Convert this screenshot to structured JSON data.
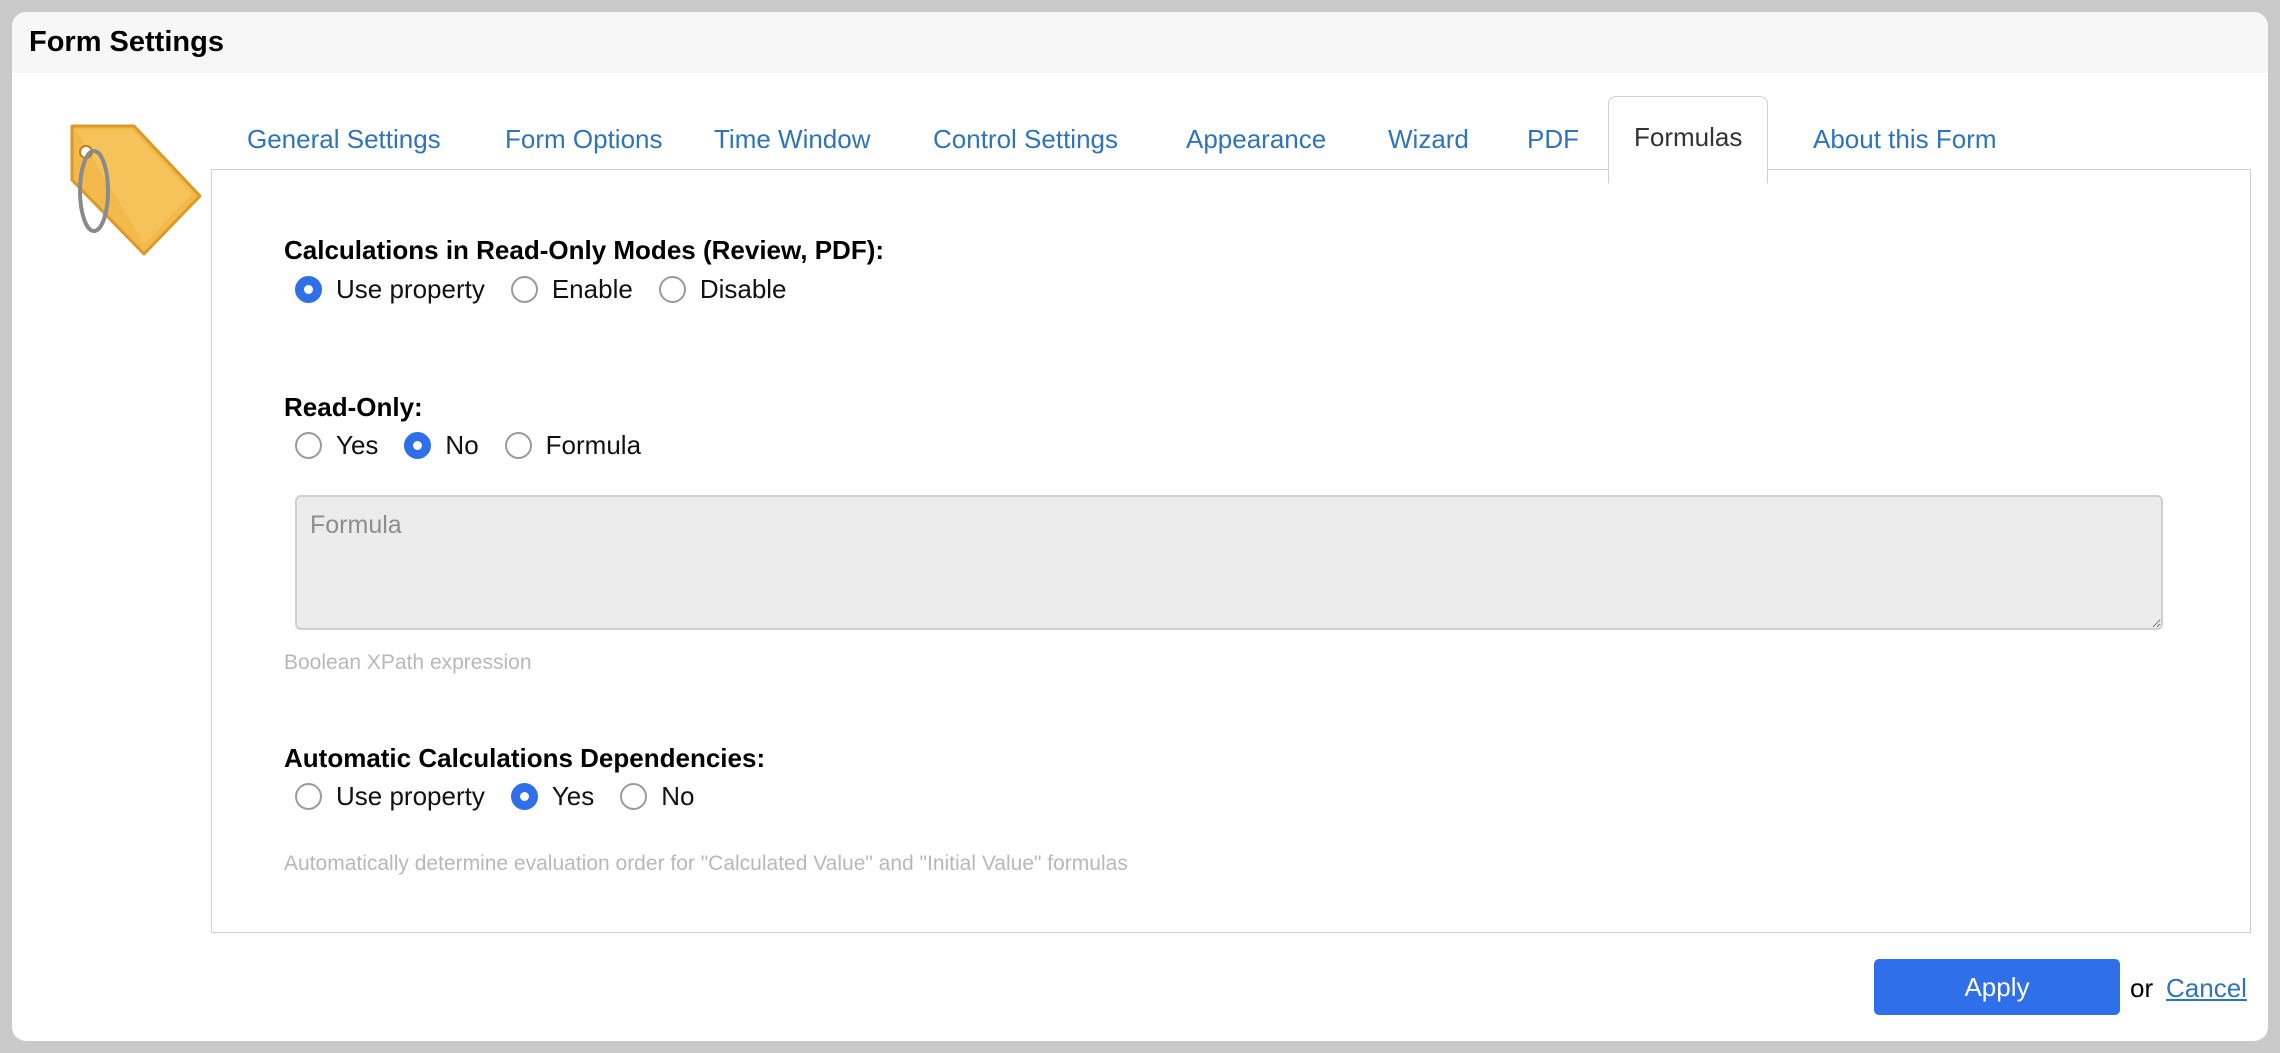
{
  "dialog": {
    "title": "Form Settings"
  },
  "icons": {
    "logo": "tag-icon",
    "grip": "resize-grip-icon"
  },
  "colors": {
    "accent": "#2f6fea",
    "link": "#2f74b9",
    "tag": "#f3b94a"
  },
  "tabs": [
    {
      "label": "General Settings",
      "active": false
    },
    {
      "label": "Form Options",
      "active": false
    },
    {
      "label": "Time Window",
      "active": false
    },
    {
      "label": "Control Settings",
      "active": false
    },
    {
      "label": "Appearance",
      "active": false
    },
    {
      "label": "Wizard",
      "active": false
    },
    {
      "label": "PDF",
      "active": false
    },
    {
      "label": "Formulas",
      "active": true
    },
    {
      "label": "About this Form",
      "active": false
    }
  ],
  "calc_readonly": {
    "label": "Calculations in Read-Only Modes (Review, PDF):",
    "options": [
      "Use property",
      "Enable",
      "Disable"
    ],
    "selected": "Use property"
  },
  "read_only": {
    "label": "Read-Only:",
    "options": [
      "Yes",
      "No",
      "Formula"
    ],
    "selected": "No",
    "formula_placeholder": "Formula",
    "formula_value": "",
    "hint": "Boolean XPath expression"
  },
  "auto_deps": {
    "label": "Automatic Calculations Dependencies:",
    "options": [
      "Use property",
      "Yes",
      "No"
    ],
    "selected": "Yes",
    "hint": "Automatically determine evaluation order for \"Calculated Value\" and \"Initial Value\" formulas"
  },
  "footer": {
    "apply": "Apply",
    "or": "or",
    "cancel": "Cancel"
  }
}
